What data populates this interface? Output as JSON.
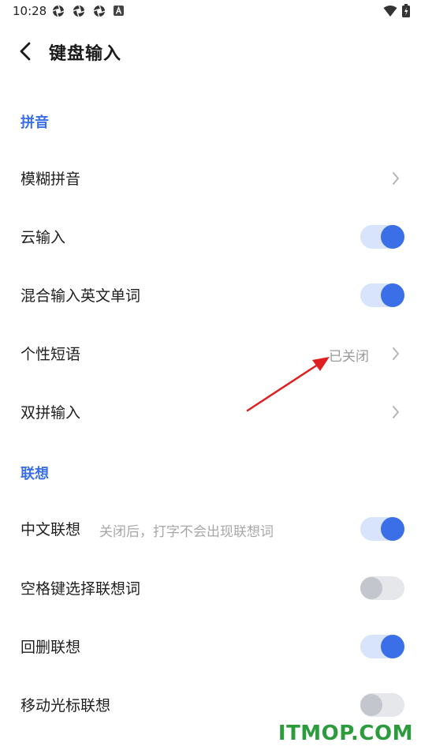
{
  "status_bar": {
    "time": "10:28",
    "icons": [
      "aperture-icon",
      "aperture-icon",
      "aperture-icon",
      "a-box-icon",
      "wifi-icon",
      "battery-icon"
    ]
  },
  "header": {
    "back_icon": "chevron-left-icon",
    "title": "键盘输入"
  },
  "sections": {
    "pinyin": {
      "title": "拼音"
    },
    "association": {
      "title": "联想"
    }
  },
  "rows": {
    "fuzzy_pinyin": {
      "label": "模糊拼音",
      "control": "chevron"
    },
    "cloud_input": {
      "label": "云输入",
      "control": "toggle",
      "on": true
    },
    "mixed_english": {
      "label": "混合输入英文单词",
      "control": "toggle",
      "on": true
    },
    "personal_phrases": {
      "label": "个性短语",
      "value": "已关闭",
      "control": "chevron"
    },
    "double_pinyin": {
      "label": "双拼输入",
      "control": "chevron"
    },
    "chinese_association": {
      "label": "中文联想",
      "sublabel": "关闭后，打字不会出现联想词",
      "control": "toggle",
      "on": true
    },
    "space_select_association": {
      "label": "空格键选择联想词",
      "control": "toggle",
      "on": false
    },
    "backspace_association": {
      "label": "回删联想",
      "control": "toggle",
      "on": true
    },
    "cursor_move_association": {
      "label": "移动光标联想",
      "control": "toggle",
      "on": false
    }
  },
  "colors": {
    "accent": "#3a6fe8",
    "toggle_on_track": "#d8e4fb",
    "toggle_off_track": "#e6e7ea",
    "annotation": "#e02020",
    "watermark": "#2c9b3c"
  },
  "watermark": "ITMOP.COM"
}
